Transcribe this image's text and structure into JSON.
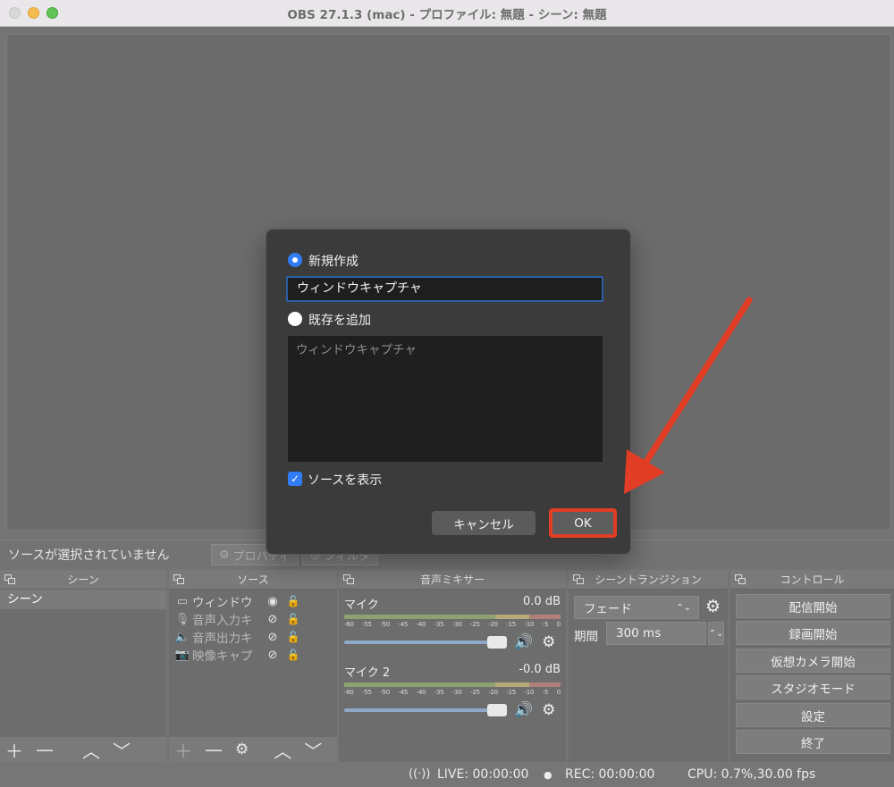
{
  "window": {
    "title": "OBS 27.1.3 (mac) - プロファイル: 無題 - シーン: 無題"
  },
  "source_toolbar": {
    "no_selection": "ソースが選択されていません",
    "properties": "プロパティ",
    "filters": "フィルタ"
  },
  "docks": {
    "scenes": {
      "title": "シーン",
      "items": [
        "シーン"
      ]
    },
    "sources": {
      "title": "ソース",
      "items": [
        {
          "icon": "window-icon",
          "name": "ウィンドウ"
        },
        {
          "icon": "mic-icon",
          "name": "音声入力キ"
        },
        {
          "icon": "speaker-icon",
          "name": "音声出力キ"
        },
        {
          "icon": "camera-icon",
          "name": "映像キャプ"
        }
      ]
    },
    "mixer": {
      "title": "音声ミキサー",
      "ticks": [
        "-60",
        "-55",
        "-50",
        "-45",
        "-40",
        "-35",
        "-30",
        "-25",
        "-20",
        "-15",
        "-10",
        "-5",
        "0"
      ],
      "channels": [
        {
          "name": "マイク",
          "level": "0.0 dB",
          "volume_fraction": 0.95
        },
        {
          "name": "マイク 2",
          "level": "-0.0 dB",
          "volume_fraction": 0.95
        }
      ]
    },
    "transitions": {
      "title": "シーントランジション",
      "selected": "フェード",
      "duration_label": "期間",
      "duration_value": "300 ms"
    },
    "controls": {
      "title": "コントロール",
      "buttons": [
        "配信開始",
        "録画開始",
        "仮想カメラ開始",
        "スタジオモード",
        "設定",
        "終了"
      ]
    }
  },
  "status": {
    "live": "LIVE: 00:00:00",
    "rec": "REC: 00:00:00",
    "cpu": "CPU: 0.7%,30.00 fps"
  },
  "dialog": {
    "create_new_label": "新規作成",
    "new_name_value": "ウィンドウキャプチャ",
    "add_existing_label": "既存を追加",
    "existing_items": [
      "ウィンドウキャプチャ"
    ],
    "show_source_label": "ソースを表示",
    "cancel_label": "キャンセル",
    "ok_label": "OK"
  },
  "colors": {
    "accent": "#2f7cf6",
    "highlight": "#e23d25"
  }
}
